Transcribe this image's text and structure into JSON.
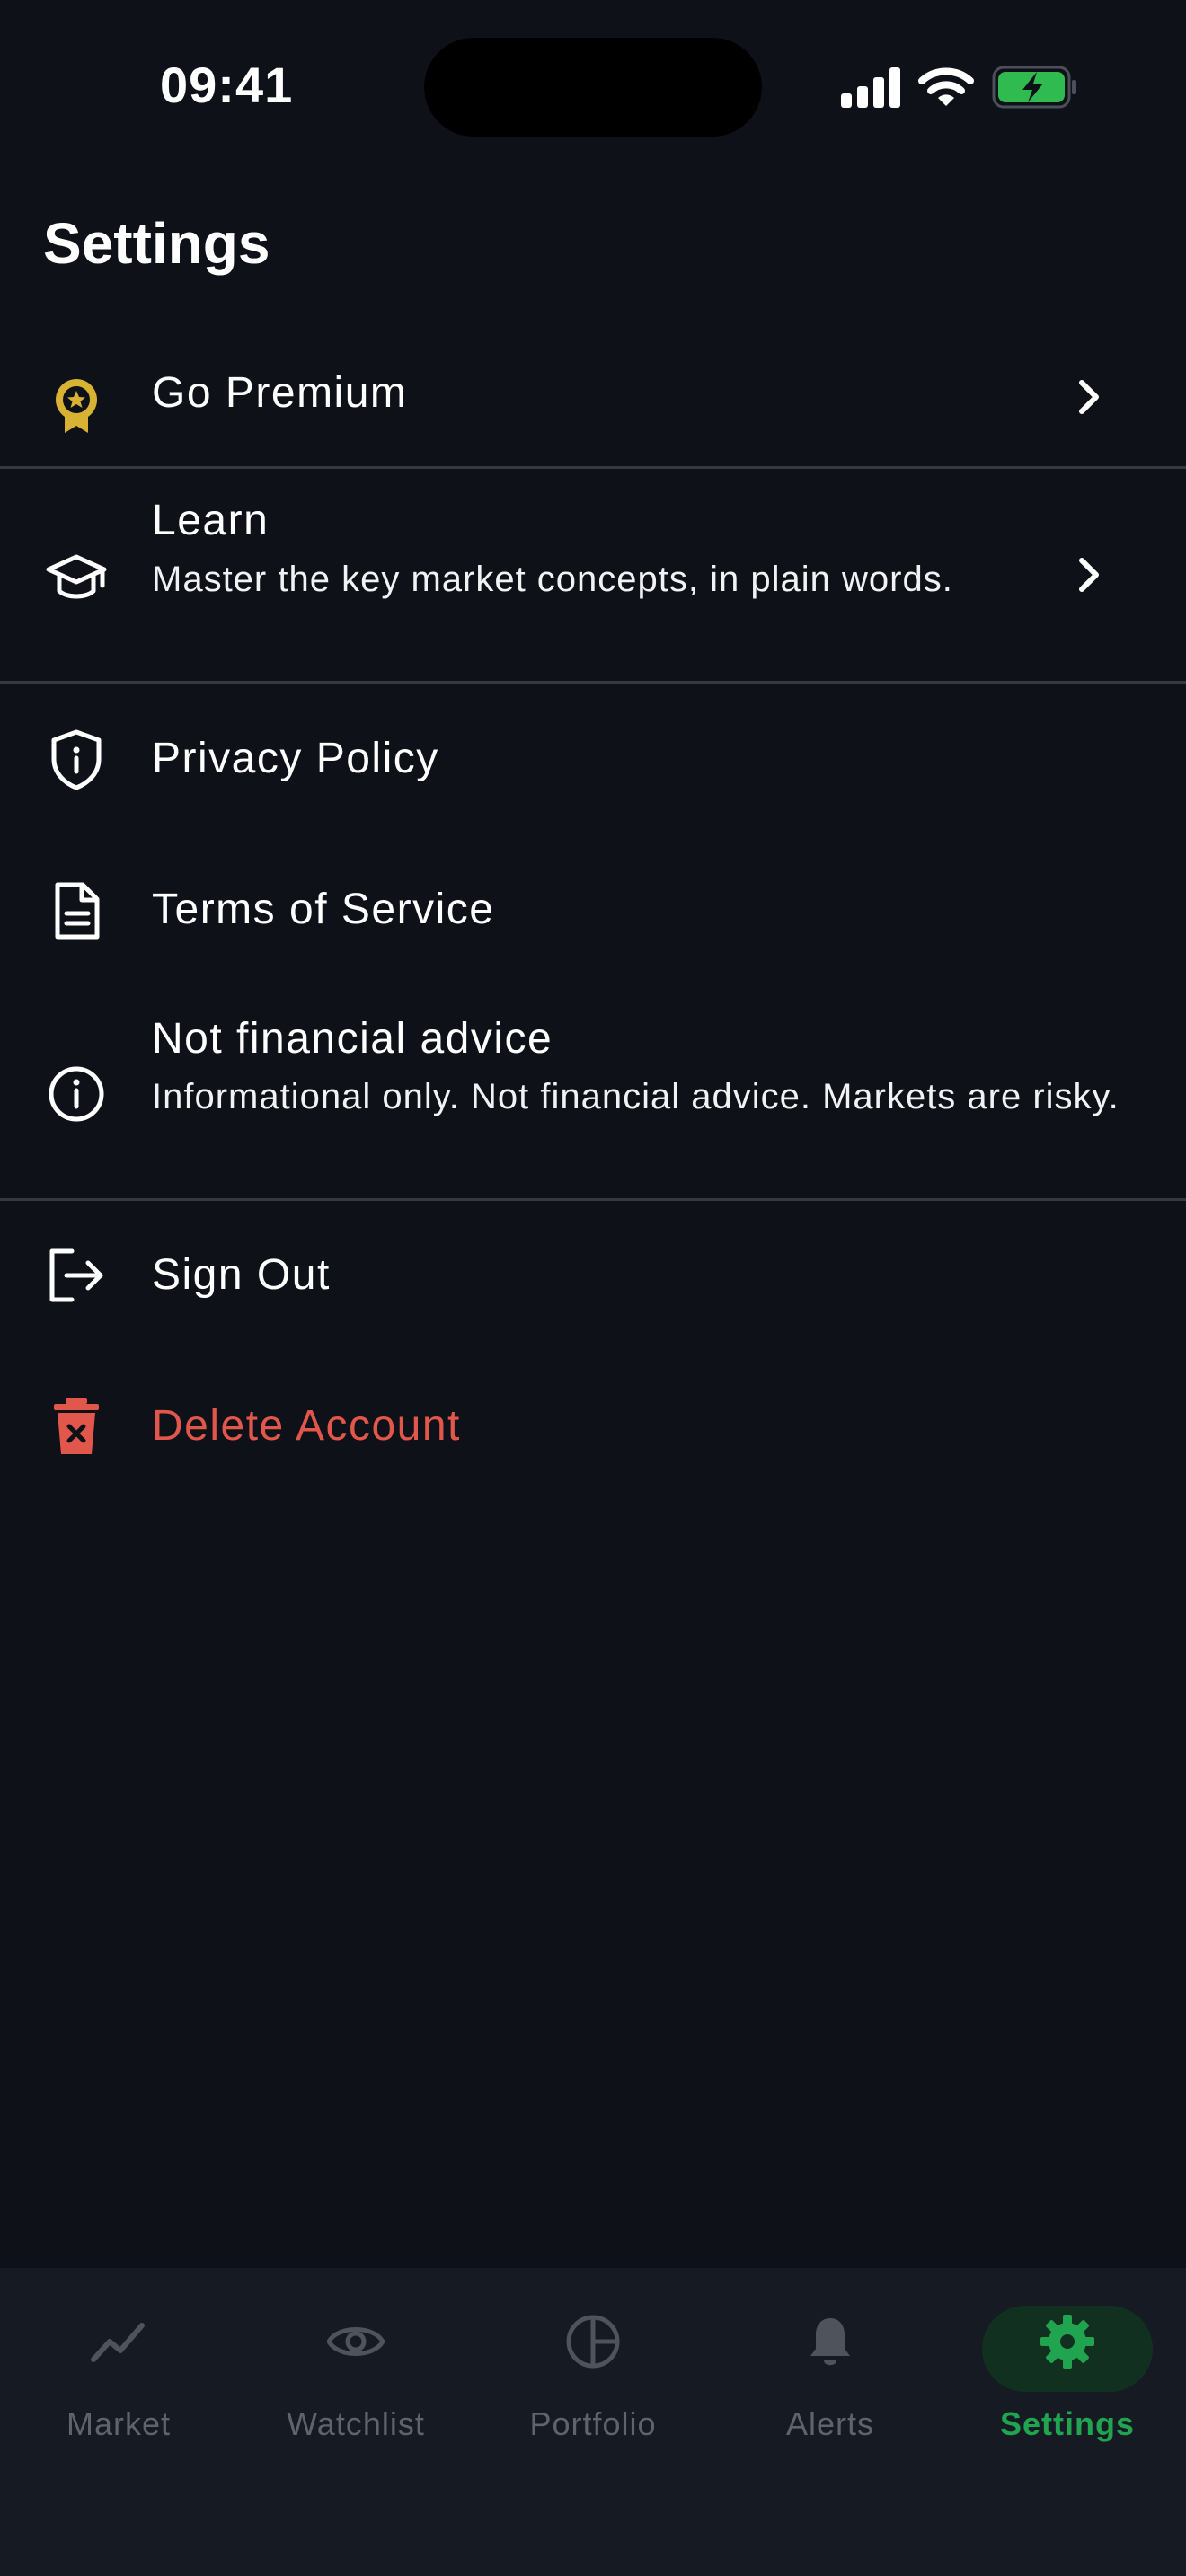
{
  "status_bar": {
    "time": "09:41",
    "icons": [
      "cellular-signal-icon",
      "wifi-icon",
      "battery-charging-icon"
    ],
    "battery_color": "#2fbb4f"
  },
  "header": {
    "title": "Settings"
  },
  "settings": {
    "premium": {
      "label": "Go Premium",
      "icon": "award-badge-icon",
      "accent": "#d8b233"
    },
    "learn": {
      "label": "Learn",
      "subtitle": "Master the key market concepts, in plain words.",
      "icon": "graduation-cap-icon"
    },
    "privacy": {
      "label": "Privacy Policy",
      "icon": "shield-info-icon"
    },
    "terms": {
      "label": "Terms of Service",
      "icon": "document-icon"
    },
    "advice": {
      "label": "Not financial advice",
      "subtitle": "Informational only. Not financial advice. Markets are risky.",
      "icon": "info-circle-icon"
    },
    "signout": {
      "label": "Sign Out",
      "icon": "sign-out-icon"
    },
    "delete": {
      "label": "Delete Account",
      "icon": "trash-icon",
      "color": "#e2574c"
    }
  },
  "tabbar": {
    "active": "Settings",
    "active_color": "#21a44f",
    "tabs": [
      {
        "label": "Market",
        "icon": "trend-line-icon"
      },
      {
        "label": "Watchlist",
        "icon": "eye-icon"
      },
      {
        "label": "Portfolio",
        "icon": "pie-chart-icon"
      },
      {
        "label": "Alerts",
        "icon": "bell-icon"
      },
      {
        "label": "Settings",
        "icon": "gear-icon"
      }
    ]
  }
}
